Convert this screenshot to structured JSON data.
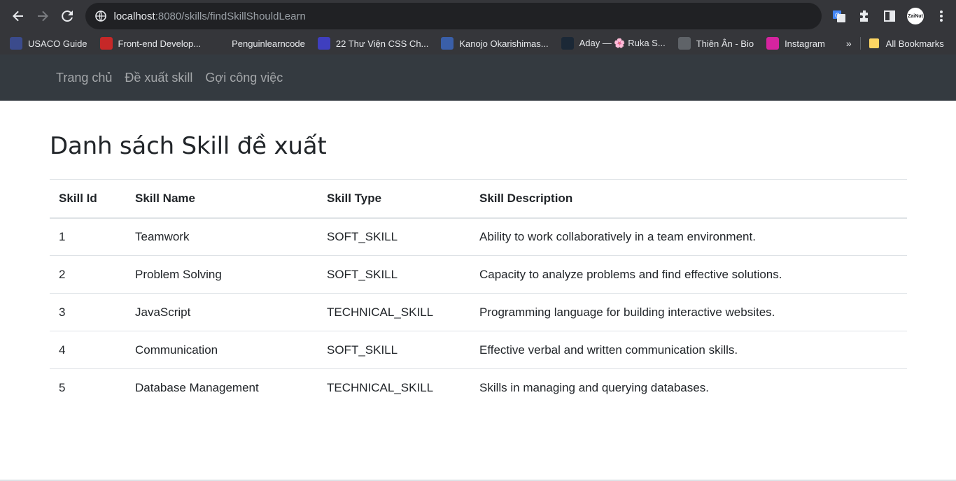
{
  "browser": {
    "url_host": "localhost",
    "url_rest": ":8080/skills/findSkillShouldLearn",
    "avatar_text": "ZaiNut"
  },
  "bookmarks": [
    {
      "label": "USACO Guide",
      "icon": "usaco-icon",
      "color": "#3b4b8c"
    },
    {
      "label": "Front-end Develop...",
      "icon": "frontend-icon",
      "color": "#c62828"
    },
    {
      "label": "Penguinlearncode",
      "icon": "penguin-icon",
      "color": "#35363a"
    },
    {
      "label": "22 Thư Viện CSS Ch...",
      "icon": "n-icon",
      "color": "#3f3fbf"
    },
    {
      "label": "Kanojo Okarishimas...",
      "icon": "rc-icon",
      "color": "#3a5fa8"
    },
    {
      "label": "Aday — 🌸 Ruka S...",
      "icon": "tumblr-icon",
      "color": "#1b2836"
    },
    {
      "label": "Thiên Ân - Bio",
      "icon": "globe-icon",
      "color": "#5f6368"
    },
    {
      "label": "Instagram",
      "icon": "instagram-icon",
      "color": "#d6249f"
    }
  ],
  "bookmarks_overflow": "»",
  "all_bookmarks": "All Bookmarks",
  "nav": {
    "home": "Trang chủ",
    "suggest_skill": "Đề xuất skill",
    "suggest_job": "Gợi công việc"
  },
  "page": {
    "title": "Danh sách Skill đề xuất"
  },
  "table": {
    "headers": [
      "Skill Id",
      "Skill Name",
      "Skill Type",
      "Skill Description"
    ],
    "rows": [
      [
        "1",
        "Teamwork",
        "SOFT_SKILL",
        "Ability to work collaboratively in a team environment."
      ],
      [
        "2",
        "Problem Solving",
        "SOFT_SKILL",
        "Capacity to analyze problems and find effective solutions."
      ],
      [
        "3",
        "JavaScript",
        "TECHNICAL_SKILL",
        "Programming language for building interactive websites."
      ],
      [
        "4",
        "Communication",
        "SOFT_SKILL",
        "Effective verbal and written communication skills."
      ],
      [
        "5",
        "Database Management",
        "TECHNICAL_SKILL",
        "Skills in managing and querying databases."
      ]
    ]
  }
}
